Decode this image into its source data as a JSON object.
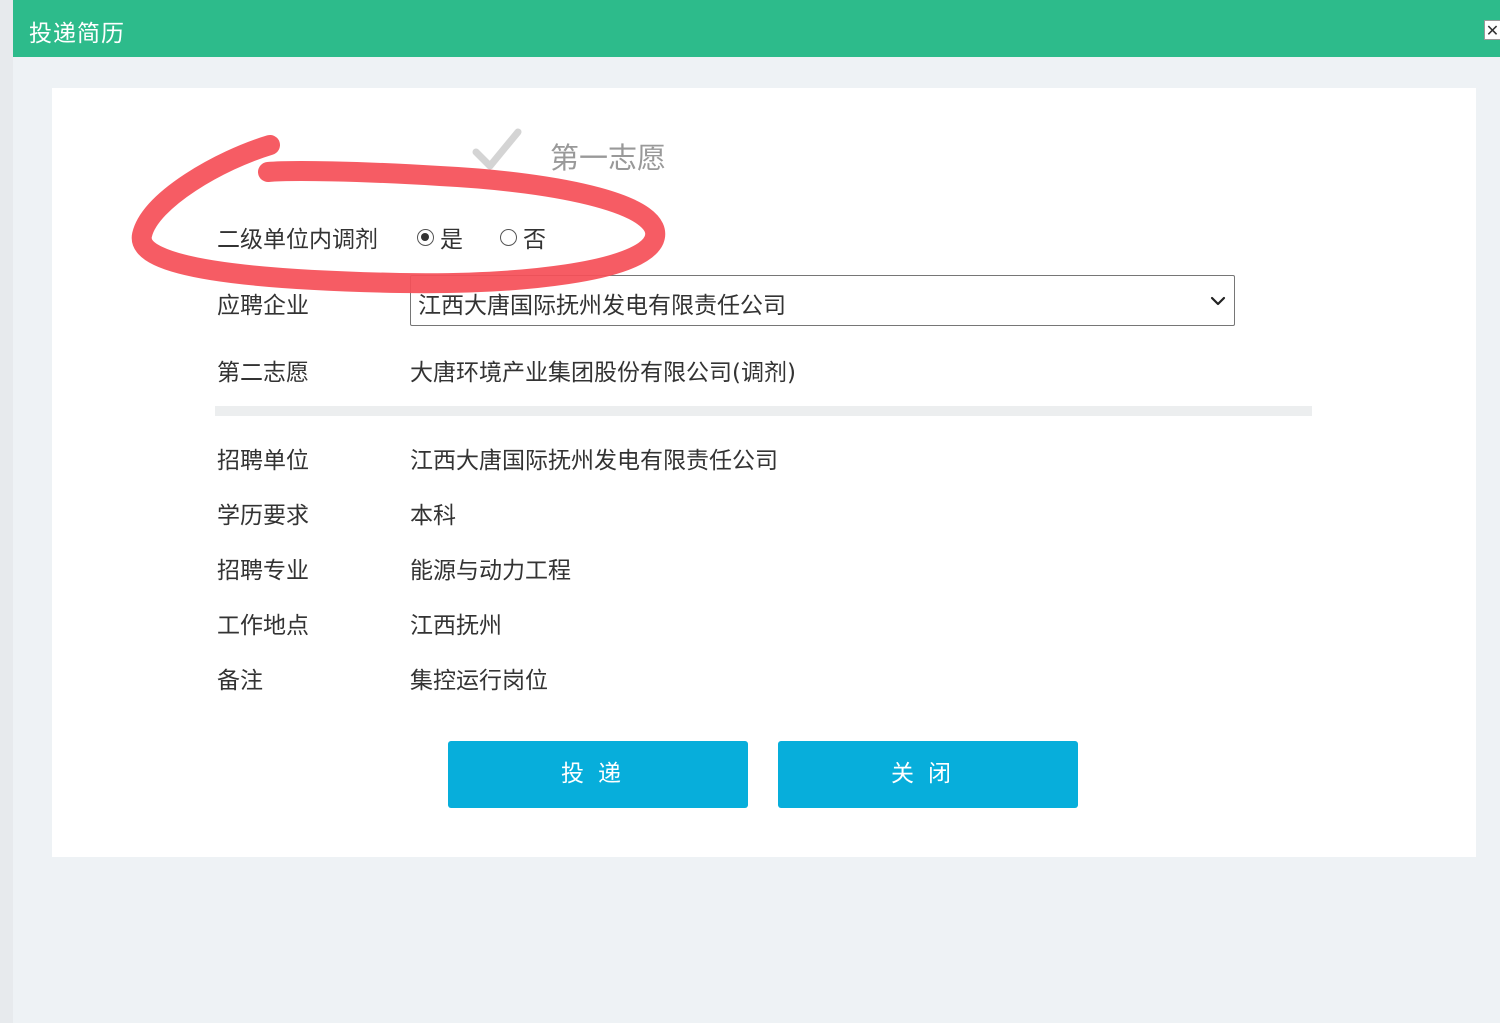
{
  "dialog": {
    "title": "投递简历",
    "close_glyph": "✕"
  },
  "choice": {
    "label": "第一志愿",
    "check_icon": "checkmark-icon"
  },
  "form": {
    "transfer": {
      "label": "二级单位内调剂",
      "options": [
        {
          "label": "是",
          "checked": true
        },
        {
          "label": "否",
          "checked": false
        }
      ]
    },
    "company": {
      "label": "应聘企业",
      "selected": "江西大唐国际抚州发电有限责任公司"
    },
    "second_choice": {
      "label": "第二志愿",
      "value": "大唐环境产业集团股份有限公司(调剂)"
    }
  },
  "details": [
    {
      "label": "招聘单位",
      "value": "江西大唐国际抚州发电有限责任公司"
    },
    {
      "label": "学历要求",
      "value": "本科"
    },
    {
      "label": "招聘专业",
      "value": "能源与动力工程"
    },
    {
      "label": "工作地点",
      "value": "江西抚州"
    },
    {
      "label": "备注",
      "value": "集控运行岗位"
    }
  ],
  "buttons": {
    "submit": "投递",
    "close": "关闭"
  },
  "colors": {
    "titlebar": "#2dbb8b",
    "button": "#07aedb",
    "annotation": "#f55058"
  }
}
